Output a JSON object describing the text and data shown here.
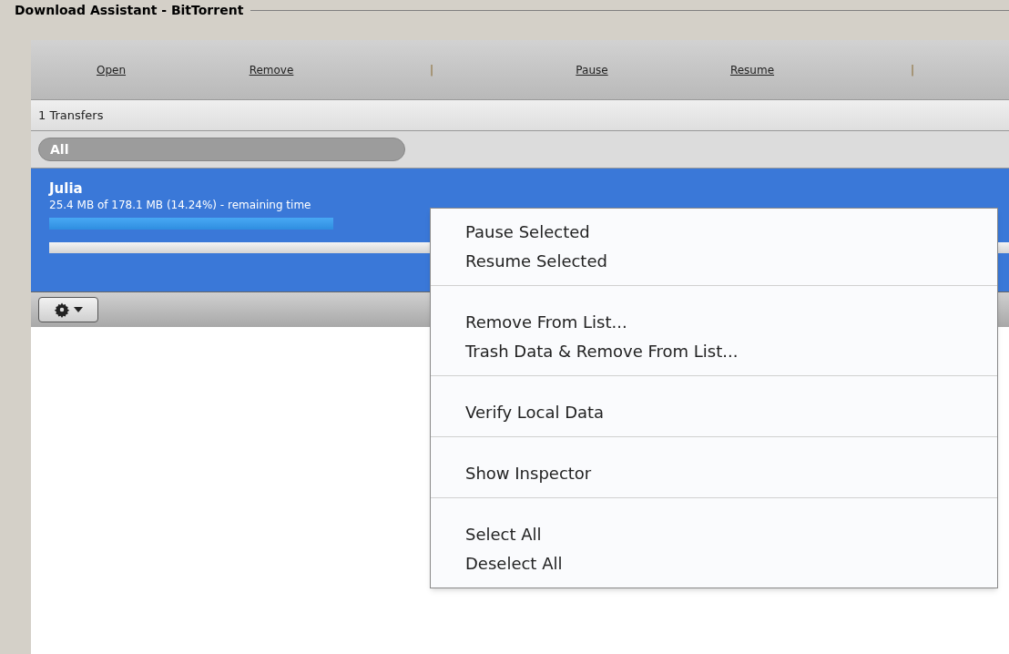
{
  "window": {
    "title": "Download Assistant - BitTorrent"
  },
  "toolbar": [
    {
      "kind": "link",
      "label": "Open"
    },
    {
      "kind": "link",
      "label": "Remove"
    },
    {
      "kind": "separator",
      "label": "|"
    },
    {
      "kind": "link",
      "label": "Pause"
    },
    {
      "kind": "link",
      "label": "Resume"
    },
    {
      "kind": "separator",
      "label": "|"
    }
  ],
  "transfer_count": "1 Transfers",
  "filter": {
    "label": "All"
  },
  "transfers": [
    {
      "name": "Julia",
      "status": "25.4 MB of 178.1 MB (14.24%) - remaining time",
      "selected": true,
      "level": 0.3
    }
  ],
  "context_menu": [
    [
      {
        "label": "Pause Selected"
      },
      {
        "label": "Resume Selected"
      }
    ],
    [
      {
        "label": "Remove From List..."
      },
      {
        "label": "Trash Data & Remove From List..."
      }
    ],
    [
      {
        "label": "Verify Local Data"
      }
    ],
    [
      {
        "label": "Show Inspector"
      }
    ],
    [
      {
        "label": "Select All"
      },
      {
        "label": "Deselect All"
      }
    ]
  ]
}
